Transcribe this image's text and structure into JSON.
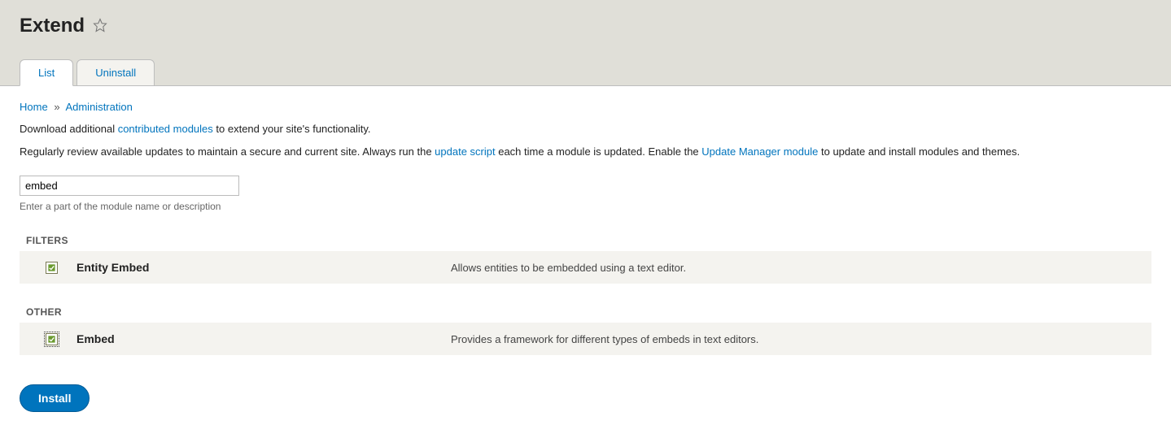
{
  "header": {
    "title": "Extend"
  },
  "tabs": {
    "list": "List",
    "uninstall": "Uninstall"
  },
  "breadcrumb": {
    "home": "Home",
    "admin": "Administration"
  },
  "help": {
    "line1_pre": "Download additional ",
    "line1_link": "contributed modules",
    "line1_post": " to extend your site's functionality.",
    "line2_pre": "Regularly review available updates to maintain a secure and current site. Always run the ",
    "line2_link1": "update script",
    "line2_mid": " each time a module is updated. Enable the ",
    "line2_link2": "Update Manager module",
    "line2_post": " to update and install modules and themes."
  },
  "filter": {
    "value": "embed",
    "description": "Enter a part of the module name or description"
  },
  "sections": [
    {
      "label": "FILTERS",
      "modules": [
        {
          "name": "Entity Embed",
          "description": "Allows entities to be embedded using a text editor.",
          "checked": true,
          "focused": false
        }
      ]
    },
    {
      "label": "OTHER",
      "modules": [
        {
          "name": "Embed",
          "description": "Provides a framework for different types of embeds in text editors.",
          "checked": true,
          "focused": true
        }
      ]
    }
  ],
  "buttons": {
    "install": "Install"
  }
}
